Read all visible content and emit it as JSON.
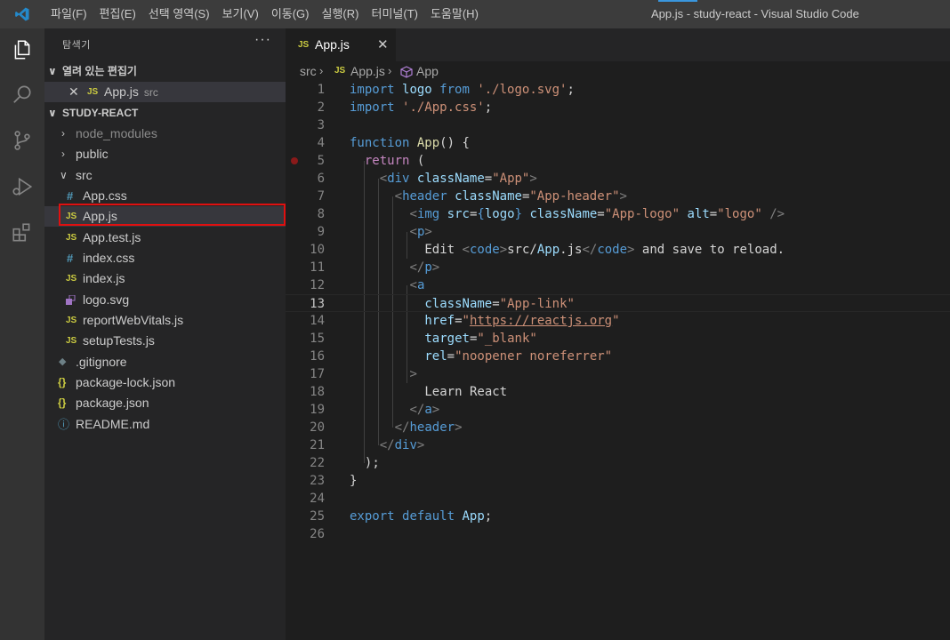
{
  "titlebar": {
    "menu": [
      "파일(F)",
      "편집(E)",
      "선택 영역(S)",
      "보기(V)",
      "이동(G)",
      "실행(R)",
      "터미널(T)",
      "도움말(H)"
    ],
    "window_title": "App.js - study-react - Visual Studio Code"
  },
  "activitybar": {
    "icons": [
      "explorer-icon",
      "search-icon",
      "source-control-icon",
      "run-debug-icon",
      "extensions-icon"
    ]
  },
  "sidebar": {
    "title": "탐색기",
    "more": "···",
    "open_editors": {
      "label": "열려 있는 편집기",
      "items": [
        {
          "name": "App.js",
          "tag": "src",
          "icon": "JS"
        }
      ]
    },
    "project": {
      "label": "STUDY-REACT",
      "items": [
        {
          "name": "node_modules",
          "kind": "folder"
        },
        {
          "name": "public",
          "kind": "folder"
        },
        {
          "name": "src",
          "kind": "folder-open"
        },
        {
          "name": "App.css",
          "icon": "#"
        },
        {
          "name": "App.js",
          "icon": "JS"
        },
        {
          "name": "App.test.js",
          "icon": "JS"
        },
        {
          "name": "index.css",
          "icon": "#"
        },
        {
          "name": "index.js",
          "icon": "JS"
        },
        {
          "name": "logo.svg",
          "icon": "svg"
        },
        {
          "name": "reportWebVitals.js",
          "icon": "JS"
        },
        {
          "name": "setupTests.js",
          "icon": "JS"
        },
        {
          "name": ".gitignore",
          "icon": "◆"
        },
        {
          "name": "package-lock.json",
          "icon": "{}"
        },
        {
          "name": "package.json",
          "icon": "{}"
        },
        {
          "name": "README.md",
          "icon": "ⓘ"
        }
      ]
    }
  },
  "editor": {
    "tab": {
      "icon": "JS",
      "label": "App.js",
      "close": "✕"
    },
    "breadcrumb": [
      "src",
      "App.js",
      "App"
    ],
    "current_line": 13,
    "breakpoint_line": 5,
    "lines": [
      "import logo from './logo.svg';",
      "import './App.css';",
      "",
      "function App() {",
      "  return (",
      "    <div className=\"App\">",
      "      <header className=\"App-header\">",
      "        <img src={logo} className=\"App-logo\" alt=\"logo\" />",
      "        <p>",
      "          Edit <code>src/App.js</code> and save to reload.",
      "        </p>",
      "        <a",
      "          className=\"App-link\"",
      "          href=\"https://reactjs.org\"",
      "          target=\"_blank\"",
      "          rel=\"noopener noreferrer\"",
      "        >",
      "          Learn React",
      "        </a>",
      "      </header>",
      "    </div>",
      "  );",
      "}",
      "",
      "export default App;",
      ""
    ]
  },
  "colors": {
    "keyword": "#569cd6",
    "control": "#c586c0",
    "string": "#ce9178",
    "variable": "#9cdcfe",
    "function": "#dcdcaa",
    "highlight_box": "#e01010"
  }
}
